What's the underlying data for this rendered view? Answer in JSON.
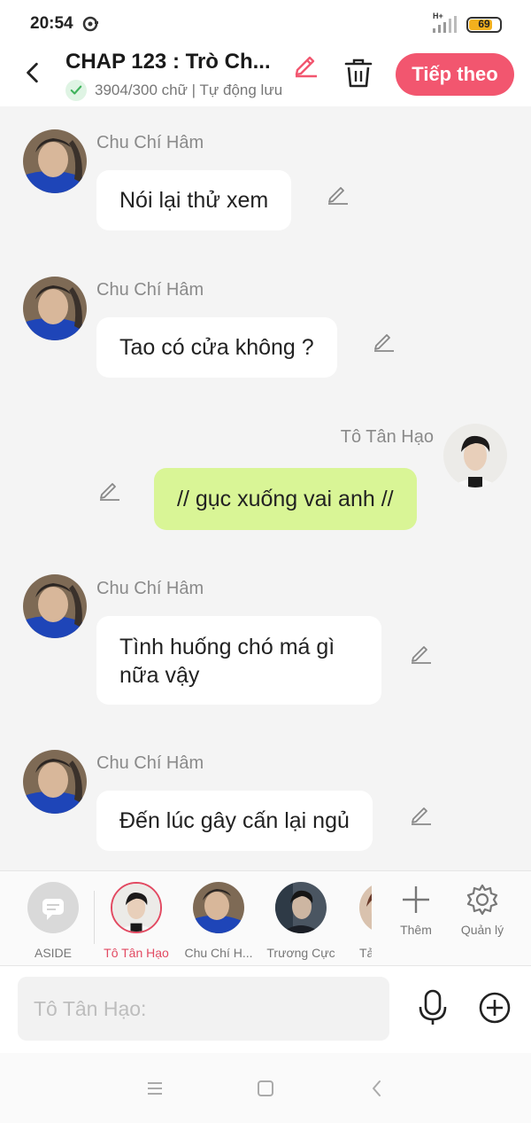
{
  "status_bar": {
    "time": "20:54",
    "network": "H+",
    "battery": "69",
    "battery_color": "#f2b01e"
  },
  "header": {
    "title": "CHAP 123 : Trò Ch...",
    "word_count": "3904/300 chữ | Tự động lưu",
    "next_label": "Tiếp theo",
    "accent_color": "#f2566f"
  },
  "messages": [
    {
      "sender": "Chu Chí Hâm",
      "text": "Nói lại thử xem",
      "mine": false
    },
    {
      "sender": "Chu Chí Hâm",
      "text": "Tao có cửa không ?",
      "mine": false
    },
    {
      "sender": "Tô Tân Hạo",
      "text": "// gục xuống vai anh //",
      "mine": true
    },
    {
      "sender": "Chu Chí Hâm",
      "text": "Tình huống chó má gì nữa vậy",
      "mine": false
    },
    {
      "sender": "Chu Chí Hâm",
      "text": "Đến lúc gây cấn lại ngủ",
      "mine": false
    }
  ],
  "characters": [
    {
      "label": "ASIDE",
      "active": false
    },
    {
      "label": "Tô Tân Hạo",
      "active": true
    },
    {
      "label": "Chu Chí H...",
      "active": false
    },
    {
      "label": "Trương Cực",
      "active": false
    },
    {
      "label": "Tả",
      "active": false
    }
  ],
  "tools": {
    "add_label": "Thêm",
    "manage_label": "Quản lý"
  },
  "input": {
    "placeholder": "Tô Tân Hạo:"
  },
  "icons": [
    "back-icon",
    "check-icon",
    "pencil-icon",
    "trash-icon",
    "mic-icon",
    "plus-circle-icon",
    "gear-icon",
    "menu-icon",
    "home-icon",
    "nav-back-icon"
  ]
}
